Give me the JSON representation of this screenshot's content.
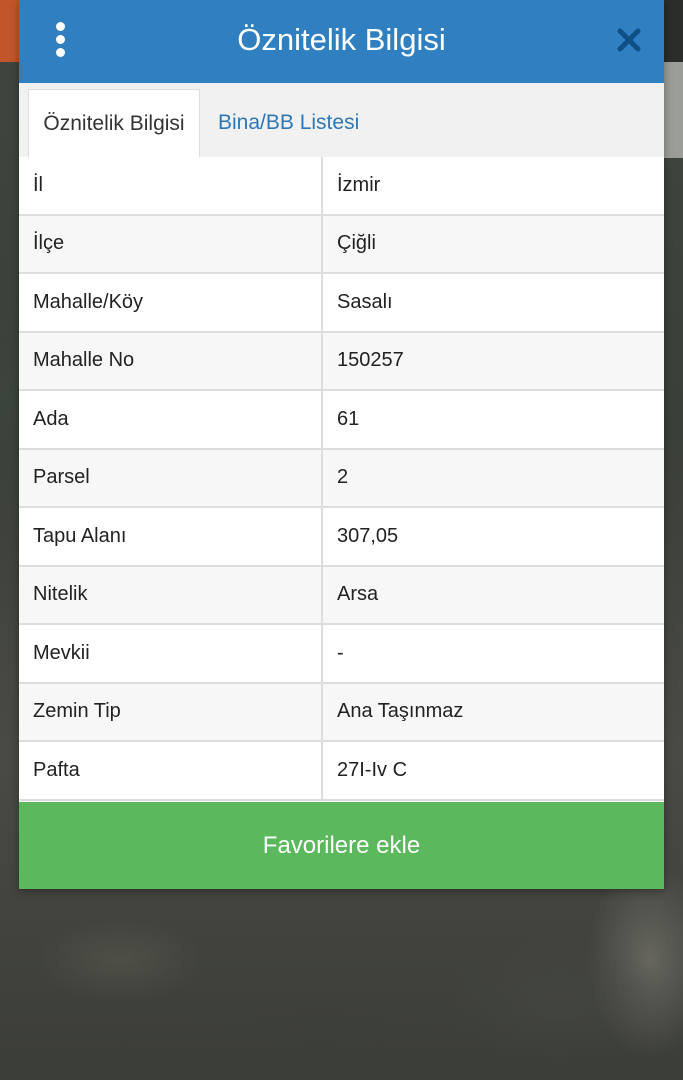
{
  "dialog": {
    "title": "Öznitelik Bilgisi",
    "menu_icon": "more-vertical-icon",
    "close_icon": "close-icon",
    "header_color": "#2f7fc1"
  },
  "tabs": [
    {
      "label": "Öznitelik Bilgisi",
      "active": true
    },
    {
      "label": "Bina/BB Listesi",
      "active": false
    }
  ],
  "attributes": [
    {
      "key": "İl",
      "value": "İzmir"
    },
    {
      "key": "İlçe",
      "value": "Çiğli"
    },
    {
      "key": "Mahalle/Köy",
      "value": "Sasalı"
    },
    {
      "key": "Mahalle No",
      "value": "150257"
    },
    {
      "key": "Ada",
      "value": "61"
    },
    {
      "key": "Parsel",
      "value": "2"
    },
    {
      "key": "Tapu Alanı",
      "value": "307,05"
    },
    {
      "key": "Nitelik",
      "value": "Arsa"
    },
    {
      "key": "Mevkii",
      "value": "-"
    },
    {
      "key": "Zemin Tip",
      "value": "Ana Taşınmaz"
    },
    {
      "key": "Pafta",
      "value": "27I-Iv C"
    }
  ],
  "favorite_button": {
    "label": "Favorilere ekle",
    "color": "#5cb85c"
  }
}
